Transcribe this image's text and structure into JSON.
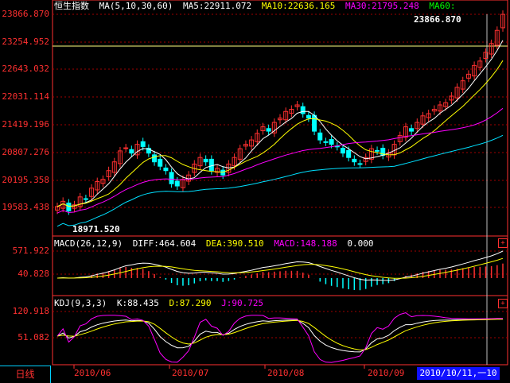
{
  "main_panel": {
    "index_name": "恒生指数",
    "ma_label": "MA(5,10,30,60)",
    "ma5": "MA5:22911.072",
    "ma10": "MA10:22636.165",
    "ma30": "MA30:21795.248",
    "ma60": "MA60:",
    "high_mark": "23866.870",
    "low_mark": "18971.520",
    "y_ticks": [
      "23866.870",
      "23254.952",
      "22643.032",
      "22031.114",
      "21419.196",
      "20807.276",
      "20195.358",
      "19583.438"
    ]
  },
  "macd_panel": {
    "title": "MACD(26,12,9)",
    "diff": "DIFF:464.604",
    "dea": "DEA:390.510",
    "macd": "MACD:148.188",
    "zero": "0.000",
    "y_ticks": [
      "571.922",
      "40.828"
    ]
  },
  "kdj_panel": {
    "title": "KDJ(9,3,3)",
    "k": "K:88.435",
    "d": "D:87.290",
    "j": "J:90.725",
    "y_ticks": [
      "120.918",
      "51.082"
    ]
  },
  "x_axis": [
    "2010/06",
    "2010/07",
    "2010/08",
    "2010/09"
  ],
  "period_button": "日线",
  "cursor_date": "2010/10/11,一",
  "cursor_date_tail": "10",
  "plus_symbol": "+",
  "colors": {
    "up": "#ff3030",
    "down": "#00ffff",
    "ma5": "#ffffff",
    "ma10": "#ffff00",
    "ma30": "#ff00ff",
    "ma60": "#00ff00",
    "grid": "#a00000",
    "axis": "#ff3030"
  },
  "chart_data": {
    "type": "candlestick",
    "close_series": [
      19480,
      19600,
      19380,
      19520,
      19700,
      19650,
      19900,
      20050,
      20100,
      20300,
      20500,
      20750,
      20820,
      20700,
      20900,
      20850,
      20700,
      20500,
      20400,
      20300,
      20000,
      19950,
      20100,
      20200,
      20450,
      20600,
      20500,
      20300,
      20350,
      20200,
      20450,
      20600,
      20800,
      20900,
      21000,
      21150,
      21300,
      21200,
      21400,
      21500,
      21650,
      21700,
      21800,
      21600,
      21500,
      21200,
      21000,
      20950,
      20900,
      20850,
      20700,
      20600,
      20500,
      20450,
      20600,
      20800,
      20750,
      20650,
      20700,
      20900,
      21100,
      21300,
      21200,
      21400,
      21550,
      21600,
      21700,
      21800,
      21850,
      22000,
      22200,
      22350,
      22500,
      22700,
      22800,
      23000,
      23200,
      23500,
      23866
    ],
    "ma5_last": 22911.072,
    "ma10_last": 22636.165,
    "ma30_last": 21795.248,
    "ylim": [
      18971.52,
      23866.87
    ]
  }
}
